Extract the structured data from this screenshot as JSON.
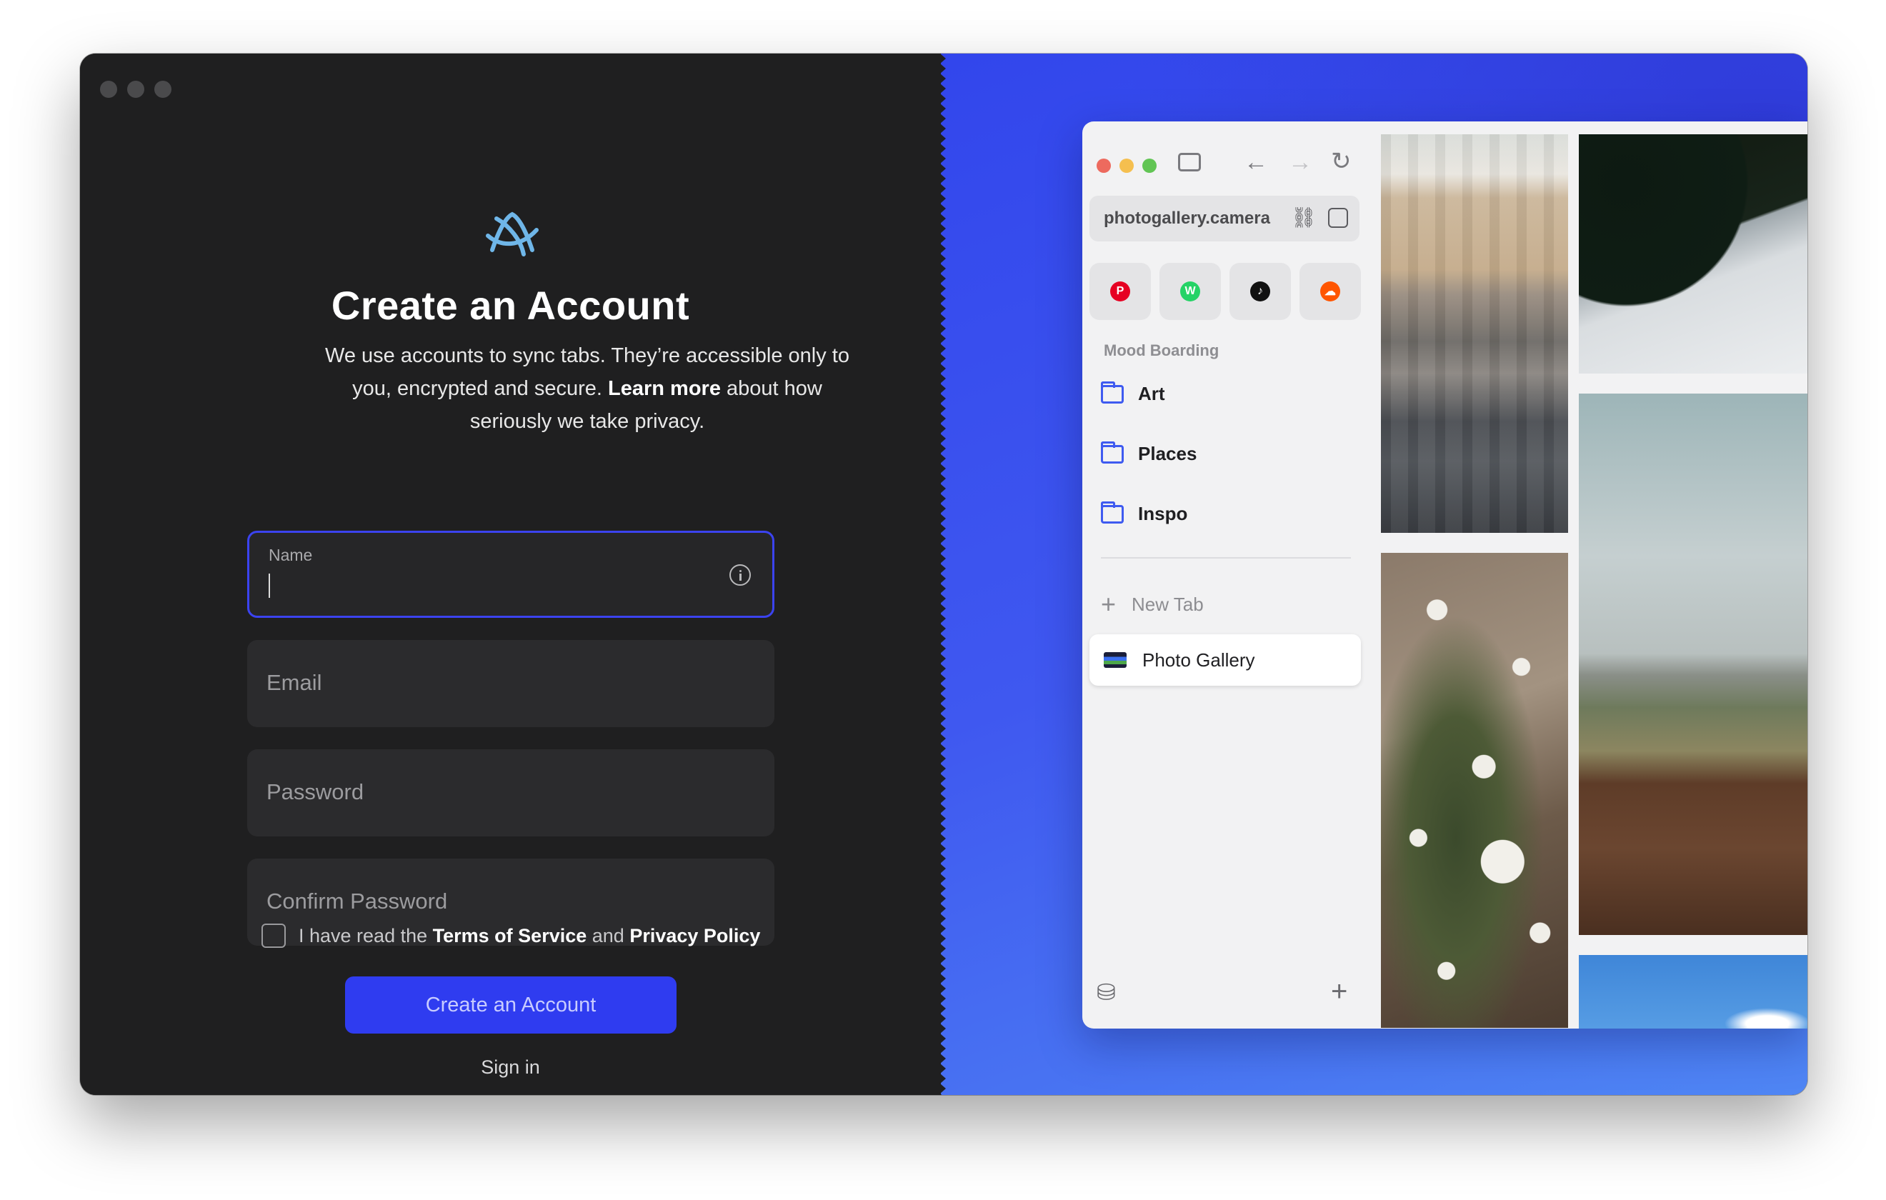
{
  "form": {
    "title": "Create an Account",
    "subtitle_pre": "We use accounts to sync tabs. They’re accessible only to you, encrypted and secure. ",
    "subtitle_link": "Learn more",
    "subtitle_post": " about how seriously we take privacy.",
    "name_label": "Name",
    "email_placeholder": "Email",
    "password_placeholder": "Password",
    "confirm_placeholder": "Confirm Password",
    "terms_pre": "I have read the ",
    "terms_tos": "Terms of Service",
    "terms_and": " and ",
    "terms_privacy": "Privacy Policy",
    "create_button": "Create an Account",
    "signin_link": "Sign in"
  },
  "browser": {
    "url": "photogallery.camera",
    "pinned": [
      {
        "name": "pinterest-icon",
        "glyph": "P",
        "color": "#e60023"
      },
      {
        "name": "whatsapp-icon",
        "glyph": "W",
        "color": "#25d366"
      },
      {
        "name": "tiktok-icon",
        "glyph": "♪",
        "color": "#111111"
      },
      {
        "name": "soundcloud-icon",
        "glyph": "☁",
        "color": "#ff5500"
      }
    ],
    "section": "Mood Boarding",
    "folders": [
      "Art",
      "Places",
      "Inspo"
    ],
    "new_tab": "New Tab",
    "active_tab": "Photo Gallery"
  },
  "colors": {
    "accent": "#2f3cf0",
    "background_dark": "#1f1f20",
    "panel_blue": "#3f58f0"
  }
}
